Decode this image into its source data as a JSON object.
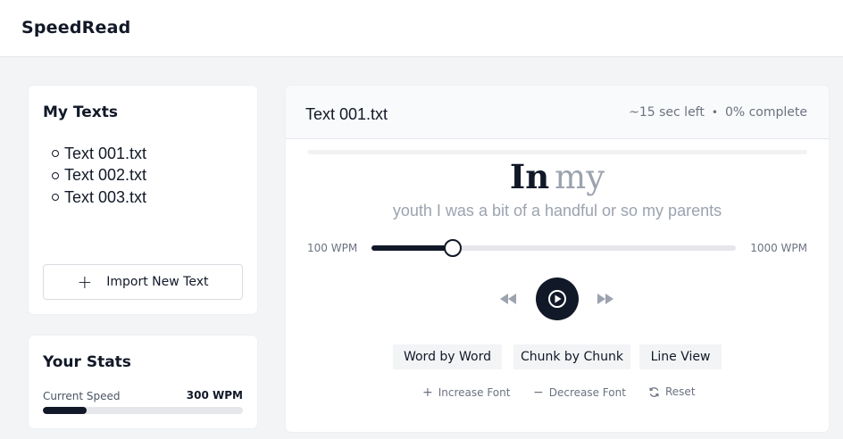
{
  "app": {
    "name": "SpeedRead"
  },
  "sidebar": {
    "texts_title": "My Texts",
    "files": [
      {
        "label": "Text 001.txt"
      },
      {
        "label": "Text 002.txt"
      },
      {
        "label": "Text 003.txt"
      }
    ],
    "import_label": "Import New Text",
    "stats_title": "Your Stats",
    "current_speed_label": "Current Speed",
    "current_speed_value": "300 WPM",
    "current_speed_fraction": 0.22
  },
  "reader": {
    "doc_title": "Text 001.txt",
    "time_left": "~15 sec left",
    "separator": "•",
    "complete": "0% complete",
    "progress_percent": 0,
    "focus_word": "In",
    "next_word": "my",
    "context": "youth I was a bit of a handful or so my parents",
    "wpm_min_label": "100 WPM",
    "wpm_max_label": "1000 WPM",
    "wpm_min": 100,
    "wpm_max": 1000,
    "wpm_current": 300,
    "modes": {
      "word": "Word by Word",
      "chunk": "Chunk by Chunk",
      "line": "Line View"
    },
    "font_controls": {
      "increase": "Increase Font",
      "decrease": "Decrease Font",
      "reset": "Reset"
    }
  },
  "colors": {
    "accent": "#111827",
    "muted_text": "#9ca3af",
    "background": "#f3f4f6"
  },
  "icons": {
    "plus": "plus-icon",
    "rewind": "rewind-icon",
    "play": "play-icon",
    "forward": "fast-forward-icon",
    "minus": "minus-icon",
    "reset": "refresh-icon"
  }
}
